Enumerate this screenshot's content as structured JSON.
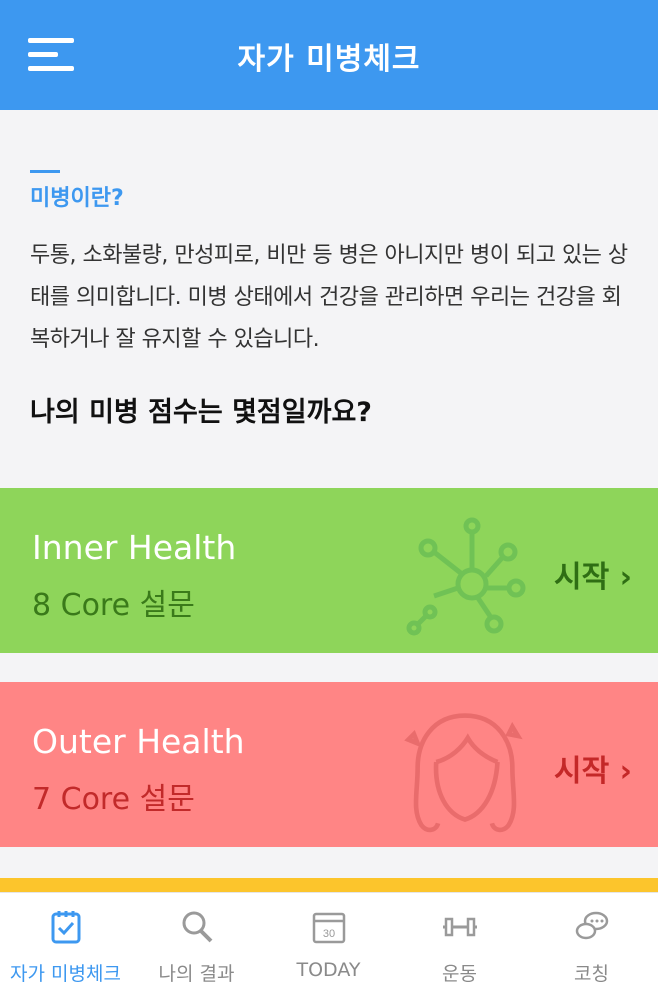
{
  "header": {
    "title": "자가 미병체크",
    "menu_icon": "hamburger-icon"
  },
  "intro": {
    "section_title": "미병이란?",
    "description": "두통, 소화불량, 만성피로, 비만 등 병은 아니지만 병이 되고 있는 상태를 의미합니다. 미병 상태에서 건강을 관리하면 우리는 건강을 회복하거나 잘 유지할 수 있습니다.",
    "question": "나의 미병 점수는 몇점일까요?"
  },
  "cards": [
    {
      "title": "Inner Health",
      "subtitle": "8 Core 설문",
      "action": "시작 ›",
      "icon": "network-nodes-icon",
      "color": "#8ed55a"
    },
    {
      "title": "Outer Health",
      "subtitle": "7 Core 설문",
      "action": "시작 ›",
      "icon": "face-sparkle-icon",
      "color": "#ff8585"
    }
  ],
  "tabbar": {
    "active_color": "#3d98f0",
    "tabs": [
      {
        "label": "자가 미병체크",
        "icon": "checklist-icon"
      },
      {
        "label": "나의 결과",
        "icon": "magnifier-icon"
      },
      {
        "label": "TODAY",
        "icon": "calendar-icon",
        "day": "30"
      },
      {
        "label": "운동",
        "icon": "dumbbell-icon"
      },
      {
        "label": "코칭",
        "icon": "chat-bubbles-icon"
      }
    ]
  }
}
